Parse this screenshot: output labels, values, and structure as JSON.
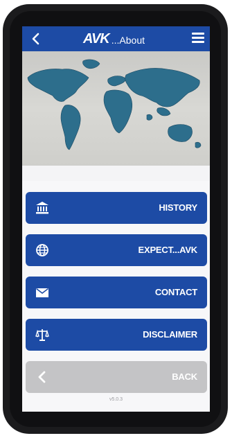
{
  "header": {
    "logo_text": "AVK",
    "title": "...About",
    "back_icon": "chevron-left-icon",
    "menu_icon": "hamburger-menu-icon"
  },
  "hero": {
    "image": "world-map-image"
  },
  "menu": {
    "items": [
      {
        "label": "HISTORY",
        "icon": "bank-building-icon"
      },
      {
        "label": "EXPECT...AVK",
        "icon": "globe-icon"
      },
      {
        "label": "CONTACT",
        "icon": "envelope-icon"
      },
      {
        "label": "DISCLAIMER",
        "icon": "scales-icon"
      }
    ],
    "back_label": "BACK"
  },
  "footer": {
    "version": "v5.0.3"
  },
  "colors": {
    "primary": "#1d4ba5",
    "disabled": "#c4c4c6"
  }
}
